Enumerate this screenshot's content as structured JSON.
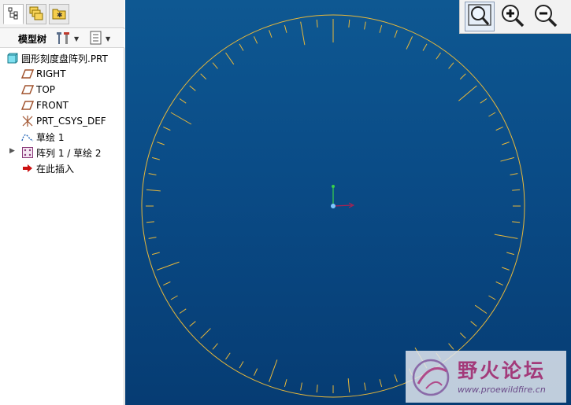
{
  "tabs": [
    {
      "icon": "model-tree-icon",
      "active": true
    },
    {
      "icon": "layers-icon",
      "active": false
    },
    {
      "icon": "favorites-folder-icon",
      "active": false
    }
  ],
  "tree_toolbar": {
    "label": "模型树",
    "settings_icon": "tree-settings-icon",
    "show_icon": "tree-show-icon"
  },
  "tree": {
    "items": [
      {
        "label": "圆形刻度盘阵列.PRT",
        "icon": "part-icon"
      },
      {
        "label": "RIGHT",
        "icon": "datum-plane-icon"
      },
      {
        "label": "TOP",
        "icon": "datum-plane-icon"
      },
      {
        "label": "FRONT",
        "icon": "datum-plane-icon"
      },
      {
        "label": "PRT_CSYS_DEF",
        "icon": "csys-icon"
      },
      {
        "label": "草绘 1",
        "icon": "sketch-icon"
      },
      {
        "label": "阵列 1 / 草绘 2",
        "icon": "pattern-icon",
        "expandable": true
      },
      {
        "label": "在此插入",
        "icon": "insert-here-arrow-icon"
      }
    ]
  },
  "view_toolbar": {
    "buttons": [
      {
        "icon": "refit-zoom-icon"
      },
      {
        "icon": "zoom-in-icon"
      },
      {
        "icon": "zoom-out-icon"
      }
    ]
  },
  "dial": {
    "tick_count": 72,
    "long_every": 10,
    "medium_every": 5,
    "color": "#e8b83a"
  },
  "watermark": {
    "title": "野火论坛",
    "url": "www.proewildfire.cn"
  },
  "colors": {
    "background_top": "#0e5892",
    "background_bottom": "#063c73",
    "dial": "#e8b83a",
    "axis_y": "#39d14a",
    "axis_x": "#b02050",
    "axis_origin": "#7fc6ff",
    "datum_plane_icon": "#a0522d",
    "insert_arrow": "#cc1111"
  }
}
